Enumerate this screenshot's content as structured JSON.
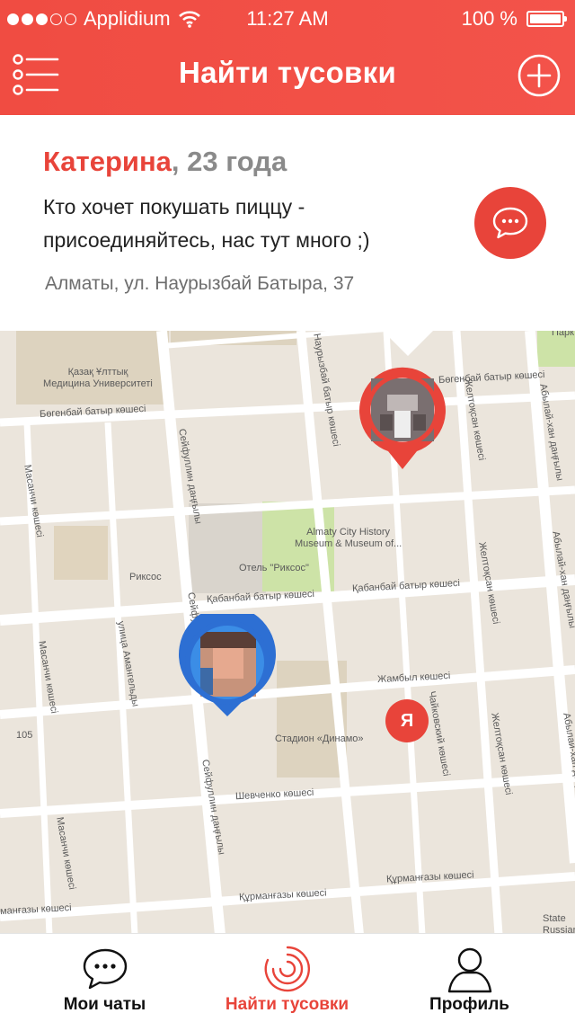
{
  "status_bar": {
    "carrier": "Applidium",
    "time": "11:27 AM",
    "battery": "100 %",
    "signal_dots_filled": 3,
    "signal_dots_total": 5,
    "wifi_icon": "wifi-icon"
  },
  "nav": {
    "title": "Найти тусовки",
    "menu_icon": "list-menu-icon",
    "add_icon": "plus-circle-icon"
  },
  "card": {
    "name": "Катерина",
    "age": ", 23 года",
    "message": "Кто хочет покушать пиццу - присоединяйтесь, нас тут много ;)",
    "address": "Алматы, ул. Наурызбай Батыра, 37",
    "chat_icon": "chat-bubble-icon"
  },
  "map": {
    "labels": {
      "university": "Қазақ Ұлттық\nМедицина Университеті",
      "bogenbay": "Бөгенбай батыр көшесі",
      "bogenbay_east": "Бөгенбай батыр көшесі",
      "naurizbay": "Наурызбай батыр көшесі",
      "museum": "Almaty City History\nMuseum & Museum of...",
      "rixos": "Риксос",
      "hotel_rixos": "Отель \"Риксос\"",
      "kabanbay": "Қабанбай батыр көшесі",
      "kabanbay_east": "Қабанбай батыр көшесі",
      "zhambyl": "Жамбыл көшесі",
      "stadium": "Стадион «Динамо»",
      "shevchenko": "Шевченко көшесі",
      "kurmangazy": "Құрманғазы көшесі",
      "kurmangazy_east": "Құрманғазы көшесі",
      "kurmangazy_west": "манғазы көшесі",
      "seyfullin_1": "Сейфуллин даңғылы",
      "seyfullin_2": "Сейфуллин даңғылы",
      "seyfullin_3": "Сейфуллин даңғылы",
      "masanchi_1": "Масанчи көшесі",
      "masanchi_2": "Масанчи көшесі",
      "masanchi_3": "Масанчи көшесі",
      "amangeldy": "улица Амангельды",
      "zheltoksan_1": "Желтоқсан көшесі",
      "zheltoksan_2": "Желтоқсан көшесі",
      "zheltoksan_3": "Желтоқсан көшесі",
      "zheltoksan_4": "Желтоқсан көшесі",
      "chaikovsky": "Чайковский көшесі",
      "ablai_1": "Абылай-хан даңғылы",
      "ablai_2": "Абылай-хан даңғылы",
      "ablai_3": "Абылай-хан даңғылы",
      "park": "Парк",
      "num_105": "105",
      "state": "State\nRussian Dr"
    },
    "me_badge": "Я"
  },
  "tabs": [
    {
      "label": "Мои чаты",
      "icon": "chat-bubble-icon"
    },
    {
      "label": "Найти тусовки",
      "icon": "radar-icon",
      "active": true
    },
    {
      "label": "Профиль",
      "icon": "user-icon"
    }
  ],
  "colors": {
    "accent": "#e8443a",
    "blue_pin": "#2d6fd3",
    "map_bg": "#ebe5dc",
    "park": "#cde3a7"
  }
}
